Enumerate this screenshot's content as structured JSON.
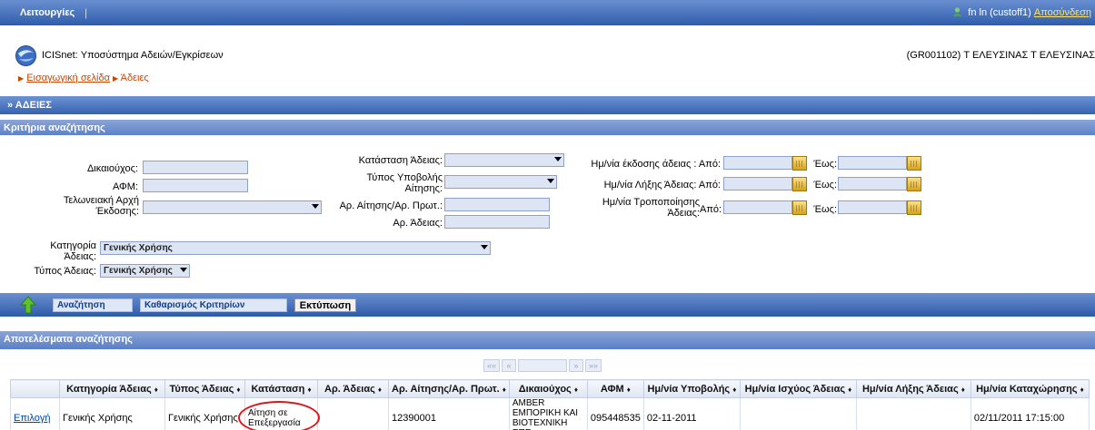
{
  "topbar": {
    "menu_label": "Λειτουργίες",
    "separator": "|",
    "user_prefix": "fn ln (custoff1)",
    "logout_label": "Αποσύνδεση"
  },
  "header": {
    "app_title": "ICISnet: Υποσύστημα Αδειών/Εγκρίσεων",
    "breadcrumb_home": "Εισαγωγική σελίδα",
    "breadcrumb_current": "Άδειες",
    "user_office": "(GR001102) Τ ΕΛΕΥΣΙΝΑΣ Τ ΕΛΕΥΣΙΝΑΣ"
  },
  "page_bar": {
    "title": "» ΑΔΕΙΕΣ"
  },
  "criteria": {
    "title": "Κριτήρια αναζήτησης",
    "holder_label": "Δικαιούχος:",
    "afm_label": "ΑΦΜ:",
    "office_label_1": "Τελωνειακή Αρχή",
    "office_label_2": "Έκδοσης:",
    "status_label": "Κατάσταση Άδειας:",
    "submission_type_label_1": "Τύπος Υποβολής",
    "submission_type_label_2": "Αίτησης:",
    "request_no_label": "Αρ. Αίτησης/Αρ. Πρωτ.:",
    "license_no_label": "Αρ. Άδειας:",
    "issue_date_label": "Ημ/νία έκδοσης άδειας : Από:",
    "expiry_date_label": "Ημ/νία Λήξης Άδειας: Από:",
    "modified_label_1": "Ημ/νία Τροποποίησης",
    "modified_label_2": "Άδειας:",
    "from_label": "Από:",
    "to_label": "Έως:",
    "category_label_1": "Κατηγορία",
    "category_label_2": "Άδειας:",
    "category_value": "Γενικής Χρήσης",
    "type_label": "Τύπος Άδειας:",
    "type_value": "Γενικής Χρήσης"
  },
  "toolbar": {
    "search_label": "Αναζήτηση",
    "clear_label": "Καθαρισμός Κριτηρίων",
    "print_label": "Εκτύπωση"
  },
  "results": {
    "title": "Αποτελέσματα αναζήτησης",
    "pager": {
      "first": "««",
      "prev": "«",
      "next": "»",
      "last": "»»"
    },
    "columns": [
      "",
      "Κατηγορία Άδειας",
      "Τύπος Άδειας",
      "Κατάσταση",
      "Αρ. Άδειας",
      "Αρ. Αίτησης/Αρ. Πρωτ.",
      "Δικαιούχος",
      "ΑΦΜ",
      "Ημ/νία Υποβολής",
      "Ημ/νία Ισχύος Άδειας",
      "Ημ/νία Λήξης Άδειας",
      "Ημ/νία Καταχώρησης"
    ],
    "sort_glyph": "♦",
    "rows": [
      {
        "select": "Επιλογή",
        "category": "Γενικής Χρήσης",
        "type": "Γενικής Χρήσης",
        "status": "Αίτηση σε Επεξεργασία",
        "license_no": "",
        "request_no": "12390001",
        "owner": "AMBER ΕΜΠΟΡΙΚΗ ΚΑΙ ΒΙΟΤΕΧΝΙΚΗ ΕΠΕ",
        "afm": "095448535",
        "submit_date": "02-11-2011",
        "valid_date": "",
        "expiry_date": "",
        "entry_date": "02/11/2011 17:15:00"
      }
    ]
  }
}
